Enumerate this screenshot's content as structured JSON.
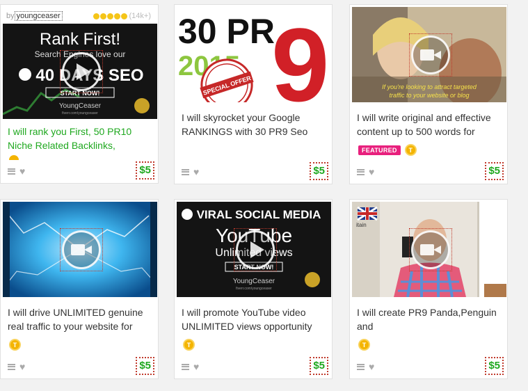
{
  "gigs": [
    {
      "seller": {
        "by": "by",
        "username": "youngceaser"
      },
      "rating_count": "(14k+)",
      "rating_stars": 5,
      "thumb": {
        "headline": "Rank First!",
        "subline": "Search Engines love our",
        "big": "40 DAYS SEO",
        "cta": "START NOW!",
        "brand": "YoungCeaser",
        "brand_sub": "fiverr.com/youngceaser"
      },
      "title": "I will rank you First, 50 PR10 Niche Related Backlinks,",
      "price": "$5"
    },
    {
      "thumb": {
        "big1": "30 PR",
        "big2": "2015",
        "big3": "9",
        "stamp": "SPECIAL OFFER"
      },
      "title": "I will skyrocket your Google RANKINGS with 30 PR9 Seo",
      "price": "$5"
    },
    {
      "thumb": {
        "caption1": "If you're looking to attract targeted",
        "caption2": "traffic to your website or blog"
      },
      "title": "I will write original and effective content up to 500 words for",
      "featured_label": "FEATURED",
      "tbadge": "T",
      "price": "$5"
    },
    {
      "title": "I will drive UNLIMITED genuine real traffic to your website for",
      "tbadge": "T",
      "price": "$5"
    },
    {
      "thumb": {
        "headline": "VIRAL SOCIAL MEDIA",
        "yt": "YouTube",
        "sub": "Unlimited views",
        "cta": "START NOW!",
        "brand": "YoungCeaser",
        "brand_sub": "fiverr.com/youngceaser"
      },
      "title": "I will promote YouTube video UNLIMITED views opportunity",
      "tbadge": "T",
      "price": "$5"
    },
    {
      "thumb": {
        "wall": "itain"
      },
      "title": "I will create PR9 Panda,Penguin and",
      "tbadge": "T",
      "price": "$5"
    }
  ]
}
